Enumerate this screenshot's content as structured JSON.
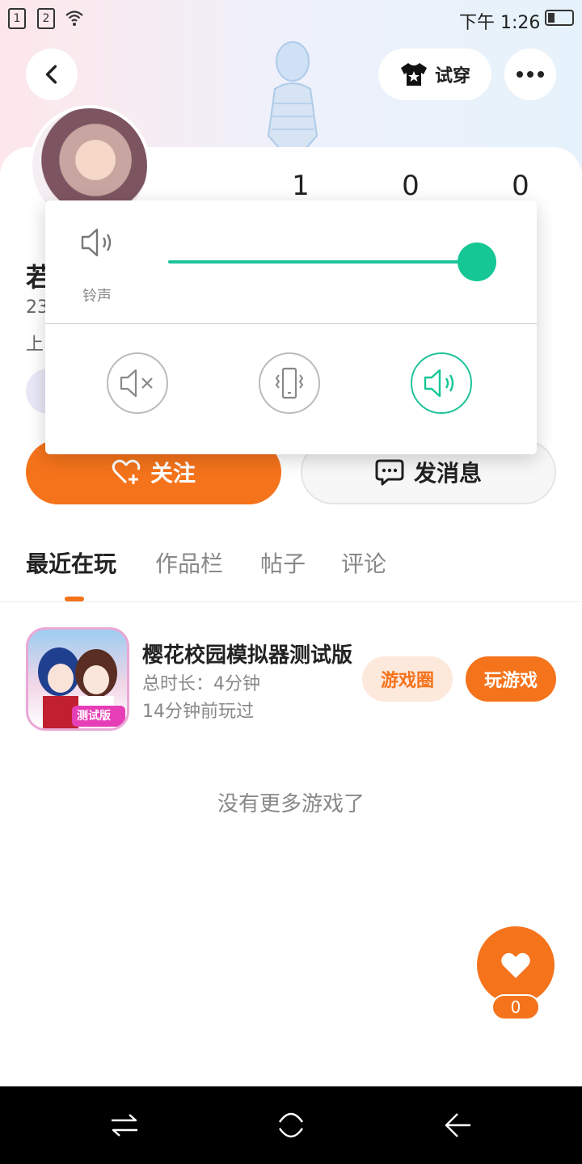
{
  "status_bar": {
    "sim1": "1",
    "sim2": "2",
    "time": "下午 1:26"
  },
  "header": {
    "try_on_label": "试穿"
  },
  "profile": {
    "stats": [
      "1",
      "0",
      "0"
    ],
    "name_fragment": "若",
    "line1_fragment": "23",
    "line2_fragment": "上"
  },
  "actions": {
    "follow_label": "关注",
    "message_label": "发消息"
  },
  "tabs": [
    {
      "label": "最近在玩",
      "active": true
    },
    {
      "label": "作品栏",
      "active": false
    },
    {
      "label": "帖子",
      "active": false
    },
    {
      "label": "评论",
      "active": false
    }
  ],
  "games": [
    {
      "title": "樱花校园模拟器测试版",
      "duration": "总时长：4分钟",
      "last_played": "14分钟前玩过",
      "icon_badge": "测试版",
      "circle_label": "游戏圈",
      "play_label": "玩游戏"
    }
  ],
  "empty_hint": "没有更多游戏了",
  "likes": {
    "count": "0"
  },
  "volume_panel": {
    "label": "铃声",
    "level": 1.0,
    "modes": [
      "mute",
      "vibrate",
      "sound"
    ],
    "active_mode": "sound"
  },
  "colors": {
    "accent": "#f5731b",
    "volume_accent": "#14c795"
  }
}
